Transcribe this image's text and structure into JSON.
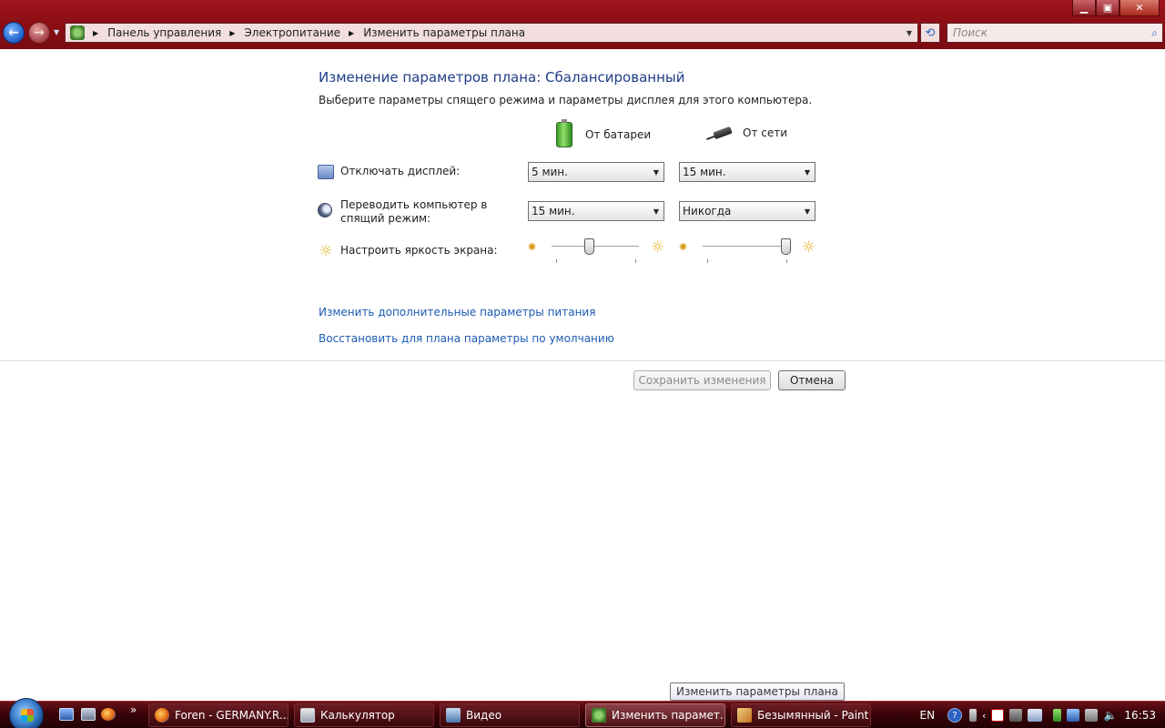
{
  "window": {
    "controls": {
      "minimize": "▁",
      "maximize": "▣",
      "close": "✕"
    }
  },
  "nav": {
    "back_icon": "←",
    "forward_icon": "→",
    "breadcrumbs": [
      "Панель управления",
      "Электропитание",
      "Изменить параметры плана"
    ],
    "search_placeholder": "Поиск",
    "refresh_icon": "⟲",
    "search_icon": "⌕"
  },
  "main": {
    "title": "Изменение параметров плана: Сбалансированный",
    "subtitle": "Выберите параметры спящего режима и параметры дисплея для этого компьютера.",
    "col_battery": "От батареи",
    "col_ac": "От сети",
    "rows": [
      {
        "label": "Отключать дисплей:",
        "battery": "5 мин.",
        "ac": "15 мин."
      },
      {
        "label": "Переводить компьютер в спящий режим:",
        "battery": "15 мин.",
        "ac": "Никогда"
      }
    ],
    "brightness": {
      "label": "Настроить яркость экрана:",
      "battery_level": 0.43,
      "ac_level": 0.95
    },
    "links": [
      "Изменить дополнительные параметры питания",
      "Восстановить для плана параметры по умолчанию"
    ],
    "save_button": "Сохранить изменения",
    "cancel_button": "Отмена"
  },
  "tooltip": "Изменить параметры плана",
  "taskbar": {
    "more": "»",
    "tasks": [
      {
        "label": "Foren - GERMANY.R..."
      },
      {
        "label": "Калькулятор"
      },
      {
        "label": "Видео"
      },
      {
        "label": "Изменить парамет..."
      },
      {
        "label": "Безымянный - Paint"
      }
    ],
    "lang": "EN",
    "help": "?",
    "clock": "16:53"
  },
  "colors": {
    "title_bar": "#8c0f15",
    "heading": "#1e3d87",
    "link": "#1c5ab4",
    "taskbar": "#3a0408"
  }
}
